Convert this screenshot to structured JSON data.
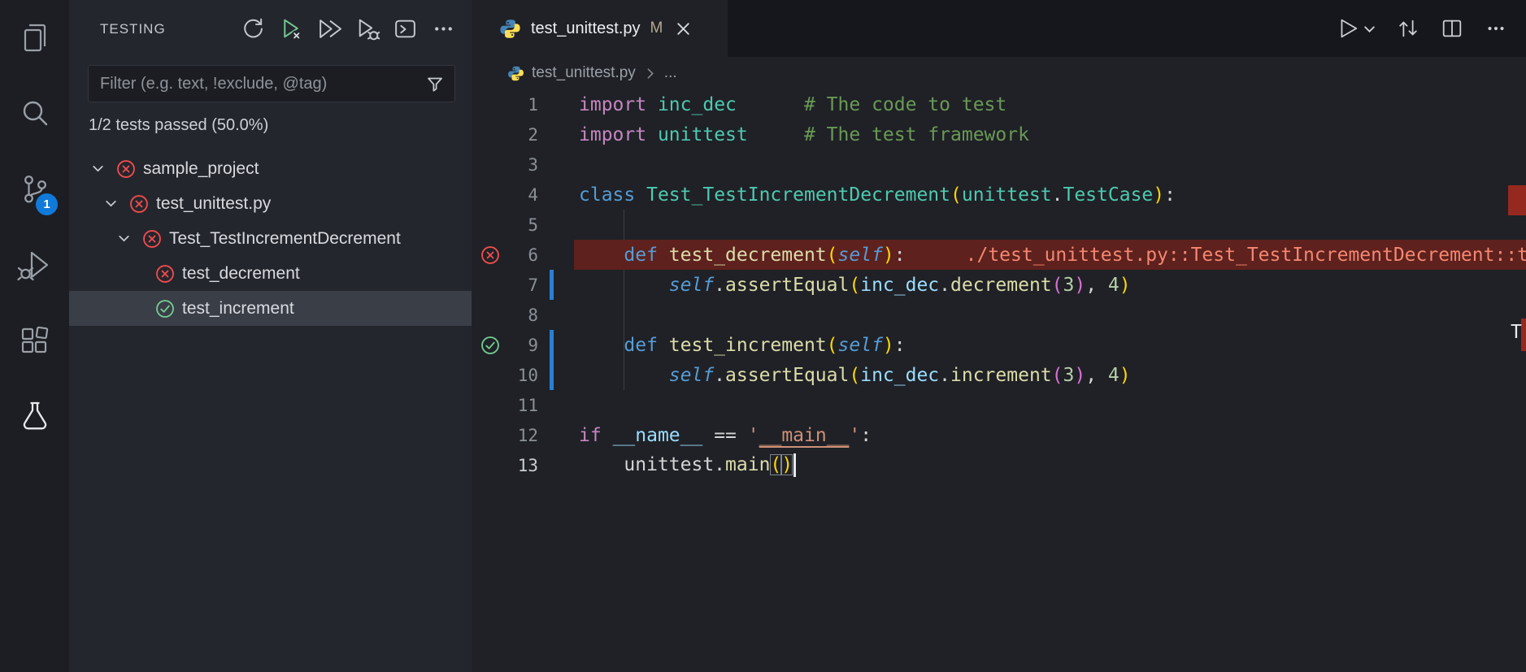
{
  "activity_bar": {
    "scm_badge": "1",
    "items": [
      "explorer",
      "search",
      "source-control",
      "run-and-debug",
      "extensions",
      "testing"
    ]
  },
  "sidebar": {
    "title": "TESTING",
    "filter_placeholder": "Filter (e.g. text, !exclude, @tag)",
    "status": "1/2 tests passed (50.0%)",
    "tree": [
      {
        "label": "sample_project",
        "state": "fail",
        "depth": 0,
        "expandable": true
      },
      {
        "label": "test_unittest.py",
        "state": "fail",
        "depth": 1,
        "expandable": true
      },
      {
        "label": "Test_TestIncrementDecrement",
        "state": "fail",
        "depth": 2,
        "expandable": true
      },
      {
        "label": "test_decrement",
        "state": "fail",
        "depth": 3,
        "expandable": false
      },
      {
        "label": "test_increment",
        "state": "pass",
        "depth": 3,
        "expandable": false,
        "selected": true
      }
    ]
  },
  "editor": {
    "tab": {
      "title": "test_unittest.py",
      "modified_badge": "M"
    },
    "breadcrumb": {
      "file": "test_unittest.py",
      "symbol": "..."
    },
    "code": {
      "lines": [
        {
          "n": "1",
          "tokens": [
            {
              "t": "import",
              "c": "kw"
            },
            {
              "t": " ",
              "c": "pln"
            },
            {
              "t": "inc_dec",
              "c": "type"
            },
            {
              "t": "      ",
              "c": "pln"
            },
            {
              "t": "# The code to test",
              "c": "com"
            }
          ]
        },
        {
          "n": "2",
          "tokens": [
            {
              "t": "import",
              "c": "kw"
            },
            {
              "t": " ",
              "c": "pln"
            },
            {
              "t": "unittest",
              "c": "type"
            },
            {
              "t": "     ",
              "c": "pln"
            },
            {
              "t": "# The test framework",
              "c": "com"
            }
          ]
        },
        {
          "n": "3",
          "tokens": []
        },
        {
          "n": "4",
          "tokens": [
            {
              "t": "class",
              "c": "kb"
            },
            {
              "t": " ",
              "c": "pln"
            },
            {
              "t": "Test_TestIncrementDecrement",
              "c": "type"
            },
            {
              "t": "(",
              "c": "b1"
            },
            {
              "t": "unittest",
              "c": "type"
            },
            {
              "t": ".",
              "c": "pln"
            },
            {
              "t": "TestCase",
              "c": "type"
            },
            {
              "t": ")",
              "c": "b1"
            },
            {
              "t": ":",
              "c": "pln"
            }
          ]
        },
        {
          "n": "5",
          "tokens": []
        },
        {
          "n": "6",
          "glyph": "fail",
          "error_bg": true,
          "error_text": "./test_unittest.py::Test_TestIncrementDecrement::test_decrement",
          "tokens": [
            {
              "t": "    ",
              "c": "pln"
            },
            {
              "t": "def",
              "c": "kb"
            },
            {
              "t": " ",
              "c": "pln"
            },
            {
              "t": "test_decrement",
              "c": "fn"
            },
            {
              "t": "(",
              "c": "b1"
            },
            {
              "t": "self",
              "c": "slf"
            },
            {
              "t": ")",
              "c": "b1"
            },
            {
              "t": ":",
              "c": "pln"
            }
          ]
        },
        {
          "n": "7",
          "tokens": [
            {
              "t": "        ",
              "c": "pln"
            },
            {
              "t": "self",
              "c": "slf"
            },
            {
              "t": ".",
              "c": "pln"
            },
            {
              "t": "assertEqual",
              "c": "fn"
            },
            {
              "t": "(",
              "c": "b1"
            },
            {
              "t": "inc_dec",
              "c": "var"
            },
            {
              "t": ".",
              "c": "pln"
            },
            {
              "t": "decrement",
              "c": "fn"
            },
            {
              "t": "(",
              "c": "b2"
            },
            {
              "t": "3",
              "c": "num"
            },
            {
              "t": ")",
              "c": "b2"
            },
            {
              "t": ", ",
              "c": "pln"
            },
            {
              "t": "4",
              "c": "num"
            },
            {
              "t": ")",
              "c": "b1"
            }
          ]
        },
        {
          "n": "8",
          "tokens": []
        },
        {
          "n": "9",
          "glyph": "pass",
          "tokens": [
            {
              "t": "    ",
              "c": "pln"
            },
            {
              "t": "def",
              "c": "kb"
            },
            {
              "t": " ",
              "c": "pln"
            },
            {
              "t": "test_increment",
              "c": "fn"
            },
            {
              "t": "(",
              "c": "b1"
            },
            {
              "t": "self",
              "c": "slf"
            },
            {
              "t": ")",
              "c": "b1"
            },
            {
              "t": ":",
              "c": "pln"
            }
          ]
        },
        {
          "n": "10",
          "tokens": [
            {
              "t": "        ",
              "c": "pln"
            },
            {
              "t": "self",
              "c": "slf"
            },
            {
              "t": ".",
              "c": "pln"
            },
            {
              "t": "assertEqual",
              "c": "fn"
            },
            {
              "t": "(",
              "c": "b1"
            },
            {
              "t": "inc_dec",
              "c": "var"
            },
            {
              "t": ".",
              "c": "pln"
            },
            {
              "t": "increment",
              "c": "fn"
            },
            {
              "t": "(",
              "c": "b2"
            },
            {
              "t": "3",
              "c": "num"
            },
            {
              "t": ")",
              "c": "b2"
            },
            {
              "t": ", ",
              "c": "pln"
            },
            {
              "t": "4",
              "c": "num"
            },
            {
              "t": ")",
              "c": "b1"
            }
          ]
        },
        {
          "n": "11",
          "tokens": []
        },
        {
          "n": "12",
          "tokens": [
            {
              "t": "if",
              "c": "kw"
            },
            {
              "t": " ",
              "c": "pln"
            },
            {
              "t": "__name__",
              "c": "var"
            },
            {
              "t": " ",
              "c": "pln"
            },
            {
              "t": "==",
              "c": "pln"
            },
            {
              "t": " ",
              "c": "pln"
            },
            {
              "t": "'",
              "c": "str"
            },
            {
              "t": "__main__",
              "c": "strU"
            },
            {
              "t": "'",
              "c": "str"
            },
            {
              "t": ":",
              "c": "pln"
            }
          ]
        },
        {
          "n": "13",
          "cursor": true,
          "tokens": [
            {
              "t": "    ",
              "c": "pln"
            },
            {
              "t": "unittest",
              "c": "pln"
            },
            {
              "t": ".",
              "c": "pln"
            },
            {
              "t": "main",
              "c": "fn"
            },
            {
              "t": "(",
              "c": "b1",
              "box": true
            },
            {
              "t": ")",
              "c": "b1",
              "box": true
            }
          ]
        }
      ]
    },
    "ruler_fragment": "T"
  },
  "colors": {
    "fail": "#f14c4c",
    "pass": "#73c991",
    "accent": "#0f7ad8",
    "modified_gutter": "#2a7fd4",
    "error_line_bg": "#5e211d",
    "error_message": "#f48771",
    "syntax": {
      "kw": "#C586C0",
      "kb": "#569CD6",
      "type": "#4EC9B0",
      "fn": "#DCDCAA",
      "var": "#9CDCFE",
      "num": "#B5CEA8",
      "str": "#CE9178",
      "com": "#6A9955",
      "pln": "#D4D4D4",
      "b1": "#FFD700",
      "b2": "#DA70D6"
    }
  }
}
